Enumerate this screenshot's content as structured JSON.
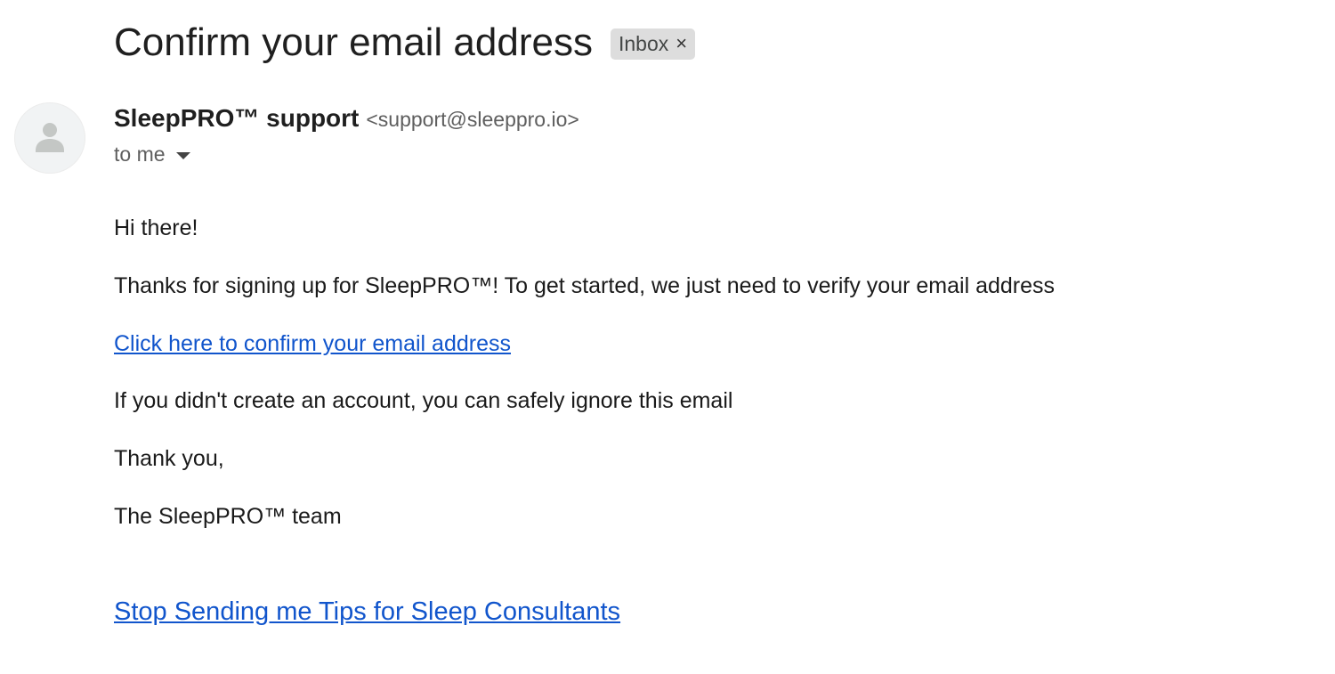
{
  "email": {
    "subject": "Confirm your email address",
    "label": "Inbox",
    "label_close_glyph": "×",
    "sender": {
      "name": "SleepPRO™ support",
      "email": "<support@sleeppro.io>"
    },
    "recipient": "to me",
    "body": {
      "greeting": "Hi there!",
      "intro": "Thanks for signing up for SleepPRO™! To get started, we just need to verify your email address",
      "confirm_link": "Click here to confirm your email address",
      "ignore_note": "If you didn't create an account, you can safely ignore this email",
      "closing": "Thank you,",
      "signature": "The SleepPRO™ team"
    },
    "footer_link": "Stop Sending me Tips for Sleep Consultants"
  },
  "colors": {
    "link": "#1155cc",
    "chip_background": "#dddddd",
    "text": "#1f1f1f",
    "muted": "#5e5e5e"
  },
  "icons": {
    "avatar": "default-person-icon",
    "recipient_toggle": "caret-down-icon",
    "label_remove": "close-icon"
  }
}
